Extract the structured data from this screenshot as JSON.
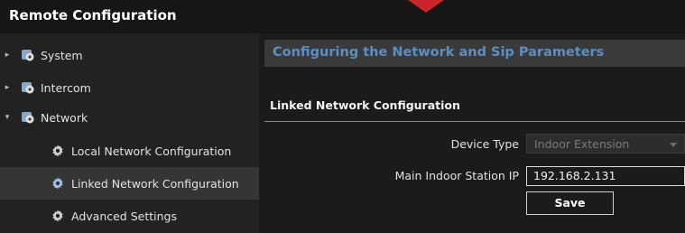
{
  "window": {
    "title": "Remote Configuration"
  },
  "sidebar": {
    "items": [
      {
        "label": "System",
        "expand": "▸"
      },
      {
        "label": "Intercom",
        "expand": "▸"
      },
      {
        "label": "Network",
        "expand": "▾"
      },
      {
        "label": "Local Network Configuration"
      },
      {
        "label": "Linked Network Configuration"
      },
      {
        "label": "Advanced Settings"
      }
    ]
  },
  "main": {
    "section_title": "Configuring the Network and Sip Parameters",
    "subsection_title": "Linked Network Configuration",
    "device_type": {
      "label": "Device Type",
      "value": "Indoor Extension"
    },
    "main_indoor_ip": {
      "label": "Main Indoor Station IP",
      "value": "192.168.2.131"
    },
    "save_label": "Save"
  },
  "colors": {
    "accent": "#5b8fc4",
    "brand": "#c9252b"
  }
}
